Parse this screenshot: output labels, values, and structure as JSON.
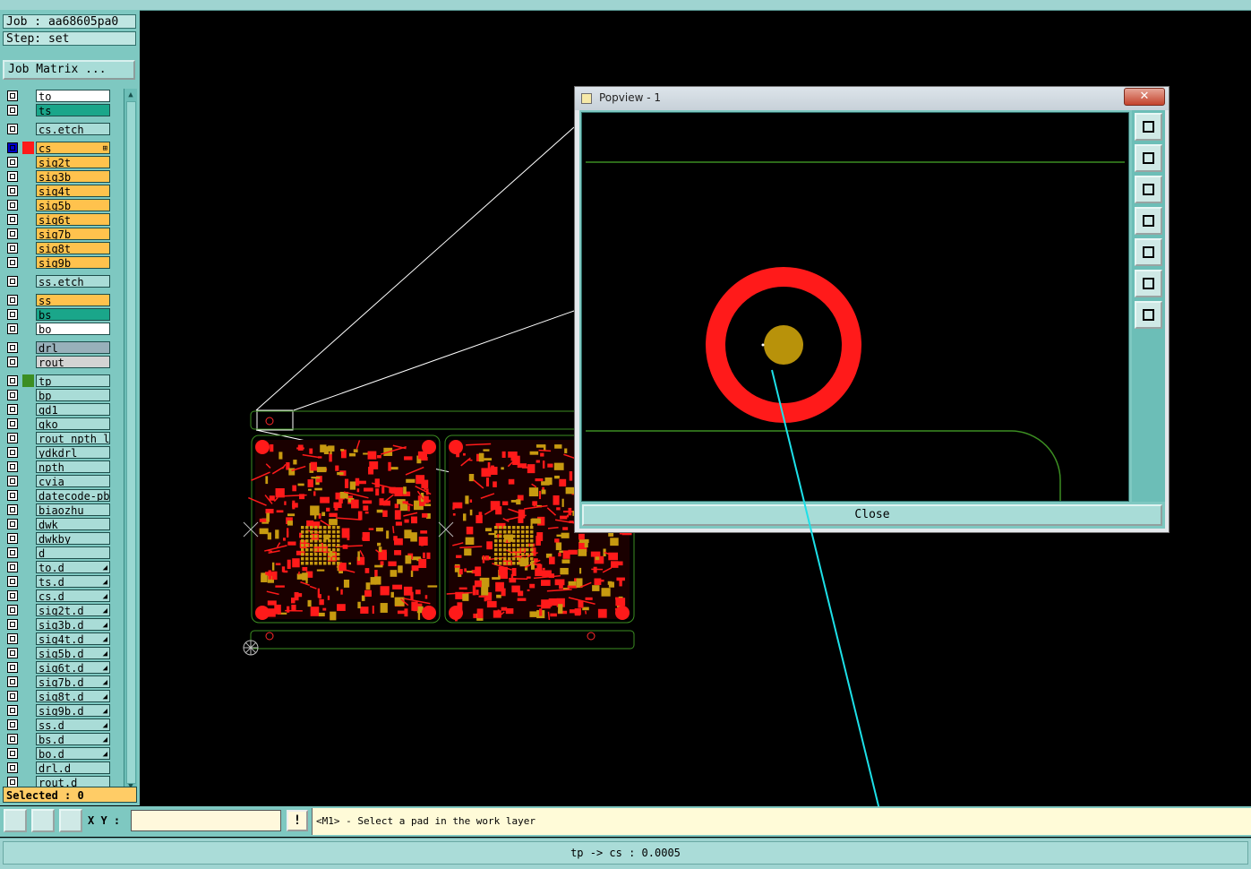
{
  "job": {
    "label": "Job : aa68605pa0",
    "step": "Step: set",
    "matrix_button": "Job Matrix ..."
  },
  "layers": [
    {
      "name": "to",
      "color": "#ffffff"
    },
    {
      "name": "ts",
      "color": "#1aa68a"
    },
    {
      "name": "cs.etch",
      "color": "#a9dcd7"
    },
    {
      "name": "cs",
      "color": "#ffc24d",
      "active": true
    },
    {
      "name": "sig2t",
      "color": "#ffc24d"
    },
    {
      "name": "sig3b",
      "color": "#ffc24d"
    },
    {
      "name": "sig4t",
      "color": "#ffc24d"
    },
    {
      "name": "sig5b",
      "color": "#ffc24d"
    },
    {
      "name": "sig6t",
      "color": "#ffc24d"
    },
    {
      "name": "sig7b",
      "color": "#ffc24d"
    },
    {
      "name": "sig8t",
      "color": "#ffc24d"
    },
    {
      "name": "sig9b",
      "color": "#ffc24d"
    },
    {
      "name": "ss.etch",
      "color": "#a9dcd7"
    },
    {
      "name": "ss",
      "color": "#ffc24d"
    },
    {
      "name": "bs",
      "color": "#1aa68a"
    },
    {
      "name": "bo",
      "color": "#ffffff"
    },
    {
      "name": "drl",
      "color": "#98b0ba"
    },
    {
      "name": "rout",
      "color": "#d3d3d3"
    },
    {
      "name": "tp",
      "color": "#a9dcd7",
      "swatch": "#3c8e22"
    },
    {
      "name": "bp",
      "color": "#a9dcd7"
    },
    {
      "name": "gd1",
      "color": "#a9dcd7"
    },
    {
      "name": "gko",
      "color": "#a9dcd7"
    },
    {
      "name": "rout_npth_la",
      "color": "#a9dcd7"
    },
    {
      "name": "ydkdrl",
      "color": "#a9dcd7"
    },
    {
      "name": "npth",
      "color": "#a9dcd7"
    },
    {
      "name": "cvia",
      "color": "#a9dcd7"
    },
    {
      "name": "datecode-pbe",
      "color": "#a9dcd7"
    },
    {
      "name": "biaozhu",
      "color": "#a9dcd7"
    },
    {
      "name": "dwk",
      "color": "#a9dcd7"
    },
    {
      "name": "dwkby",
      "color": "#a9dcd7"
    },
    {
      "name": "d",
      "color": "#a9dcd7"
    },
    {
      "name": "to.d",
      "color": "#a9dcd7",
      "flag": true
    },
    {
      "name": "ts.d",
      "color": "#a9dcd7",
      "flag": true
    },
    {
      "name": "cs.d",
      "color": "#a9dcd7",
      "flag": true
    },
    {
      "name": "sig2t.d",
      "color": "#a9dcd7",
      "flag": true
    },
    {
      "name": "sig3b.d",
      "color": "#a9dcd7",
      "flag": true
    },
    {
      "name": "sig4t.d",
      "color": "#a9dcd7",
      "flag": true
    },
    {
      "name": "sig5b.d",
      "color": "#a9dcd7",
      "flag": true
    },
    {
      "name": "sig6t.d",
      "color": "#a9dcd7",
      "flag": true
    },
    {
      "name": "sig7b.d",
      "color": "#a9dcd7",
      "flag": true
    },
    {
      "name": "sig8t.d",
      "color": "#a9dcd7",
      "flag": true
    },
    {
      "name": "sig9b.d",
      "color": "#a9dcd7",
      "flag": true
    },
    {
      "name": "ss.d",
      "color": "#a9dcd7",
      "flag": true
    },
    {
      "name": "bs.d",
      "color": "#a9dcd7",
      "flag": true
    },
    {
      "name": "bo.d",
      "color": "#a9dcd7",
      "flag": true
    },
    {
      "name": "drl.d",
      "color": "#a9dcd7"
    },
    {
      "name": "rout.d",
      "color": "#a9dcd7"
    }
  ],
  "selected_label": "Selected : 0",
  "toolbar": {
    "xy_label": "X Y :",
    "xy_value": "",
    "excl_label": "!"
  },
  "prompt": "<M1> - Select a pad in the work layer",
  "status": "tp -> cs : 0.0005",
  "popview": {
    "title": "Popview - 1",
    "close_x": "✕",
    "close_button": "Close"
  },
  "colors": {
    "pad_red": "#ff1a1a",
    "drill_gold": "#b8920a",
    "outline_green": "#3c8e22",
    "measure_cyan": "#1de0e8",
    "panel_teal": "#7ec8c1"
  }
}
